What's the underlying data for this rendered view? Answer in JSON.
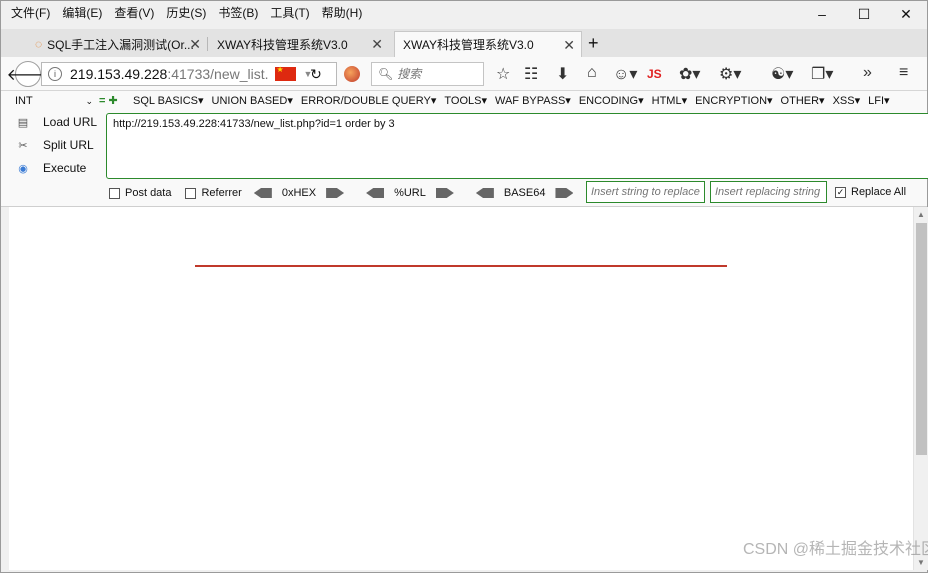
{
  "menubar": {
    "items": [
      "文件(F)",
      "编辑(E)",
      "查看(V)",
      "历史(S)",
      "书签(B)",
      "工具(T)",
      "帮助(H)"
    ],
    "min": "–",
    "max": "☐",
    "close": "✕"
  },
  "tabs": [
    {
      "title": "SQL手工注入漏洞测试(Or...",
      "active": false
    },
    {
      "title": "XWAY科技管理系统V3.0",
      "active": false
    },
    {
      "title": "XWAY科技管理系统V3.0",
      "active": true
    }
  ],
  "navbar": {
    "url_host": "219.153.49.228",
    "url_rest": ":41733/new_list.",
    "search_placeholder": "搜索"
  },
  "hackbar": {
    "select_value": "INT",
    "menu": [
      "SQL BASICS▾",
      "UNION BASED▾",
      "ERROR/DOUBLE QUERY▾",
      "TOOLS▾",
      "WAF BYPASS▾",
      "ENCODING▾",
      "HTML▾",
      "ENCRYPTION▾",
      "OTHER▾",
      "XSS▾",
      "LFI▾"
    ],
    "load_url": "Load URL",
    "split_url": "Split URL",
    "execute": "Execute",
    "url_value": "http://219.153.49.228:41733/new_list.php?id=1 order by 3",
    "post_data": "Post data",
    "referrer": "Referrer",
    "hex": "0xHEX",
    "urlenc": "%URL",
    "base64": "BASE64",
    "replace_placeholder": "Insert string to replace",
    "replacing_placeholder": "Insert replacing string",
    "replace_all": "Replace All",
    "replace_all_checked": true
  },
  "watermark": "CSDN @稀土掘金技术社区",
  "colors": {
    "accent_green": "#2c8a2c",
    "red_line": "#c0392b"
  }
}
